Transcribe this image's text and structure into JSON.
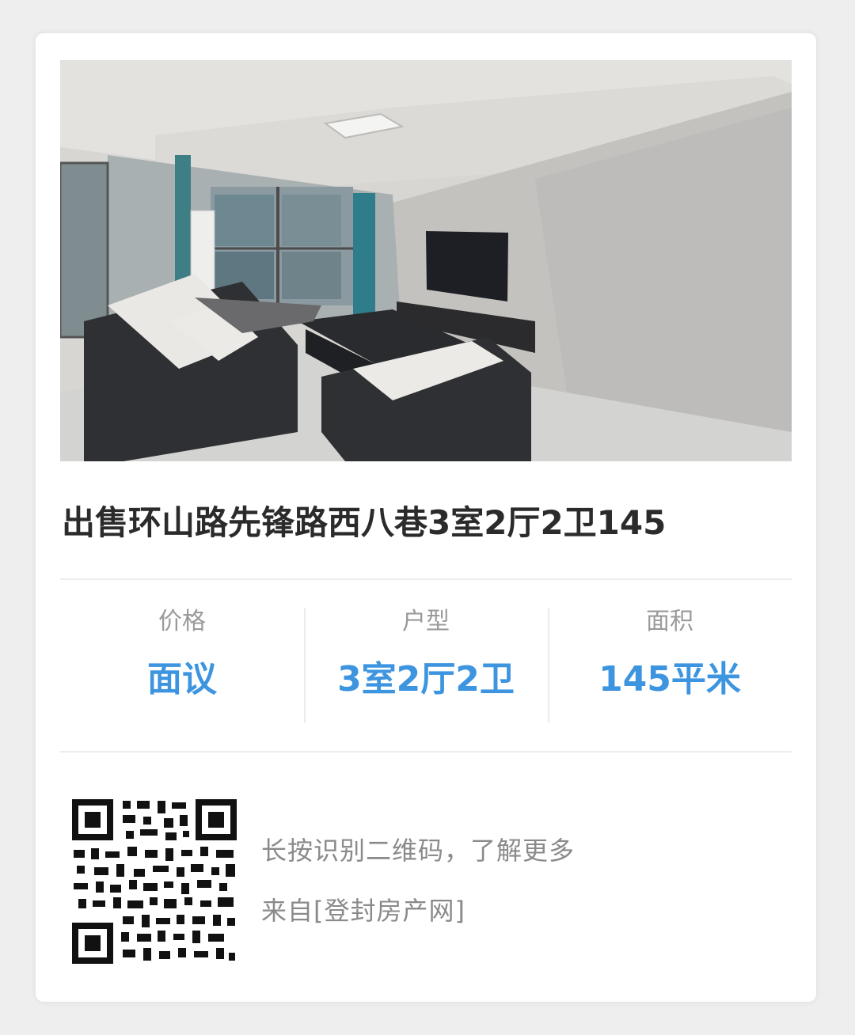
{
  "listing": {
    "title": "出售环山路先锋路西八巷3室2厅2卫145"
  },
  "stats": [
    {
      "label": "价格",
      "value": "面议"
    },
    {
      "label": "户型",
      "value": "3室2厅2卫"
    },
    {
      "label": "面积",
      "value": "145平米"
    }
  ],
  "footer": {
    "hint": "长按识别二维码，了解更多",
    "source": "来自[登封房产网]"
  },
  "colors": {
    "accent": "#3d95e0",
    "title": "#2b2b2b",
    "label": "#9a9a9a"
  },
  "icons": {
    "qr": "qr-code-icon"
  }
}
